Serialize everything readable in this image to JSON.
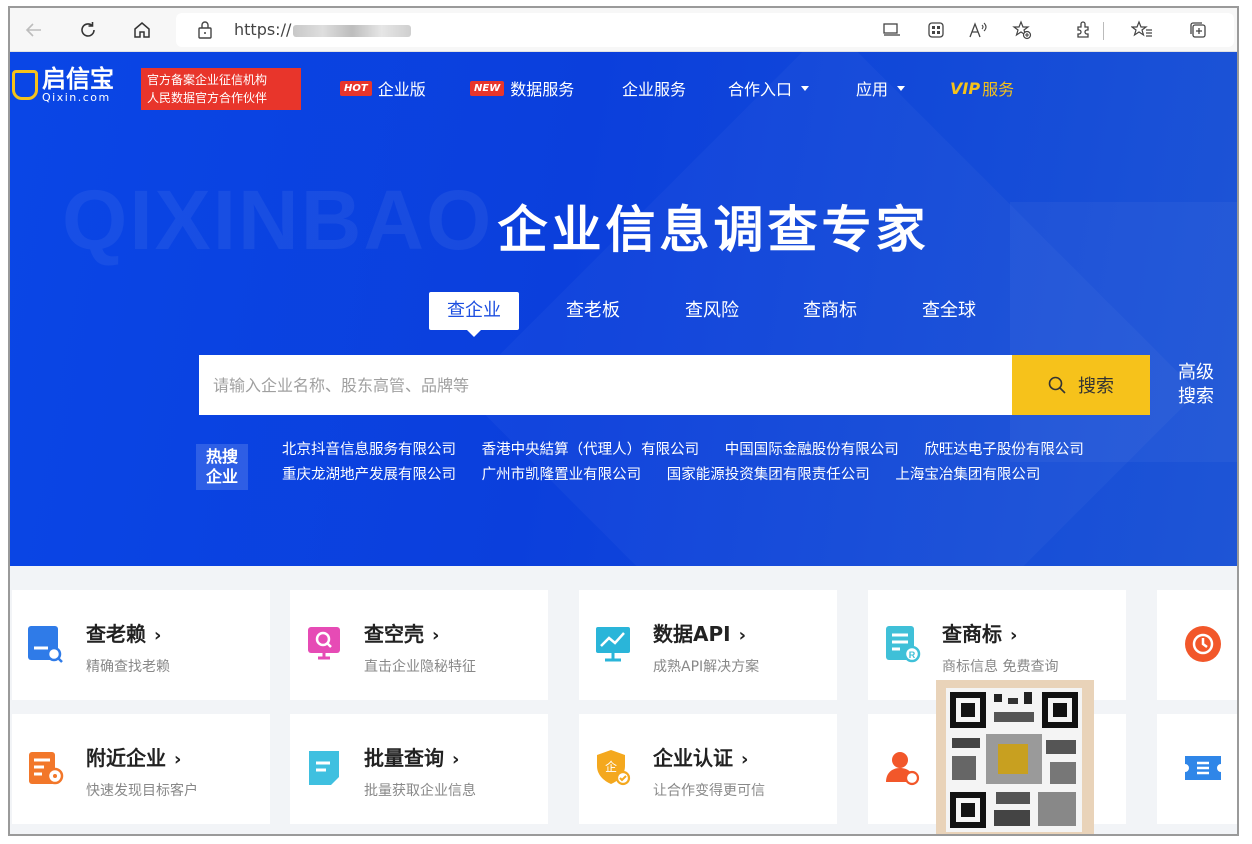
{
  "browser": {
    "url_prefix": "https://",
    "buttons": [
      "back",
      "refresh",
      "home"
    ],
    "address_actions": [
      "screen-cast",
      "apps",
      "read-aloud",
      "add-favorite",
      "extensions",
      "favorites",
      "collections"
    ]
  },
  "site": {
    "logo_cn": "启信宝",
    "logo_en": "Qixin.com",
    "badge_line1": "官方备案企业征信机构",
    "badge_line2": "人民数据官方合作伙伴"
  },
  "nav": {
    "hot_tag": "HOT",
    "enterprise": "企业版",
    "new_tag": "NEW",
    "data_service": "数据服务",
    "business_service": "企业服务",
    "partner": "合作入口",
    "apps": "应用",
    "vip_tag": "VIP",
    "vip_label": "服务"
  },
  "hero": {
    "watermark": "QIXINBAO",
    "slogan": "企业信息调查专家"
  },
  "tabs": [
    "查企业",
    "查老板",
    "查风险",
    "查商标",
    "查全球"
  ],
  "search": {
    "placeholder": "请输入企业名称、股东高管、品牌等",
    "button": "搜索",
    "advanced_line1": "高级",
    "advanced_line2": "搜索"
  },
  "hot": {
    "label_line1": "热搜",
    "label_line2": "企业",
    "row1": [
      "北京抖音信息服务有限公司",
      "香港中央結算（代理人）有限公司",
      "中国国际金融股份有限公司",
      "欣旺达电子股份有限公司"
    ],
    "row2": [
      "重庆龙湖地产发展有限公司",
      "广州市凯隆置业有限公司",
      "国家能源投资集团有限责任公司",
      "上海宝冶集团有限公司"
    ]
  },
  "cards": [
    {
      "title": "查老赖",
      "sub": "精确查找老赖",
      "icon": "debtor-search-icon",
      "color": "#2f7be8"
    },
    {
      "title": "查空壳",
      "sub": "直击企业隐秘特征",
      "icon": "shell-company-icon",
      "color": "#e64bb5"
    },
    {
      "title": "数据API",
      "sub": "成熟API解决方案",
      "icon": "api-chart-icon",
      "color": "#2ab5d9"
    },
    {
      "title": "查商标",
      "sub": "商标信息 免费查询",
      "icon": "trademark-icon",
      "color": "#3fc0d8"
    },
    {
      "title": "附近企业",
      "sub": "快速发现目标客户",
      "icon": "nearby-icon",
      "color": "#f2772a"
    },
    {
      "title": "批量查询",
      "sub": "批量获取企业信息",
      "icon": "batch-query-icon",
      "color": "#3fc0e0"
    },
    {
      "title": "企业认证",
      "sub": "让合作变得更可信",
      "icon": "certification-icon",
      "color": "#f4a81e"
    }
  ],
  "arrow": "›"
}
